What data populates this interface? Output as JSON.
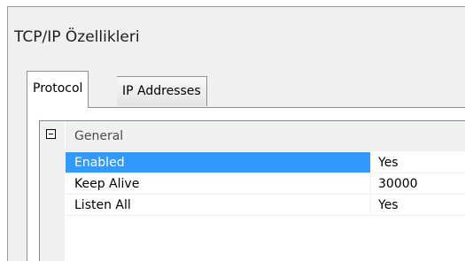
{
  "dialog": {
    "title": "TCP/IP Özellikleri"
  },
  "tabs": [
    {
      "label": "Protocol",
      "active": true
    },
    {
      "label": "IP Addresses",
      "active": false
    }
  ],
  "grid": {
    "category": "General",
    "expander_state": "expanded",
    "properties": [
      {
        "name": "Enabled",
        "value": "Yes",
        "selected": true
      },
      {
        "name": "Keep Alive",
        "value": "30000",
        "selected": false
      },
      {
        "name": "Listen All",
        "value": "Yes",
        "selected": false
      }
    ]
  },
  "colors": {
    "selection": "#3399ff",
    "window_bg": "#f0f0f0"
  }
}
